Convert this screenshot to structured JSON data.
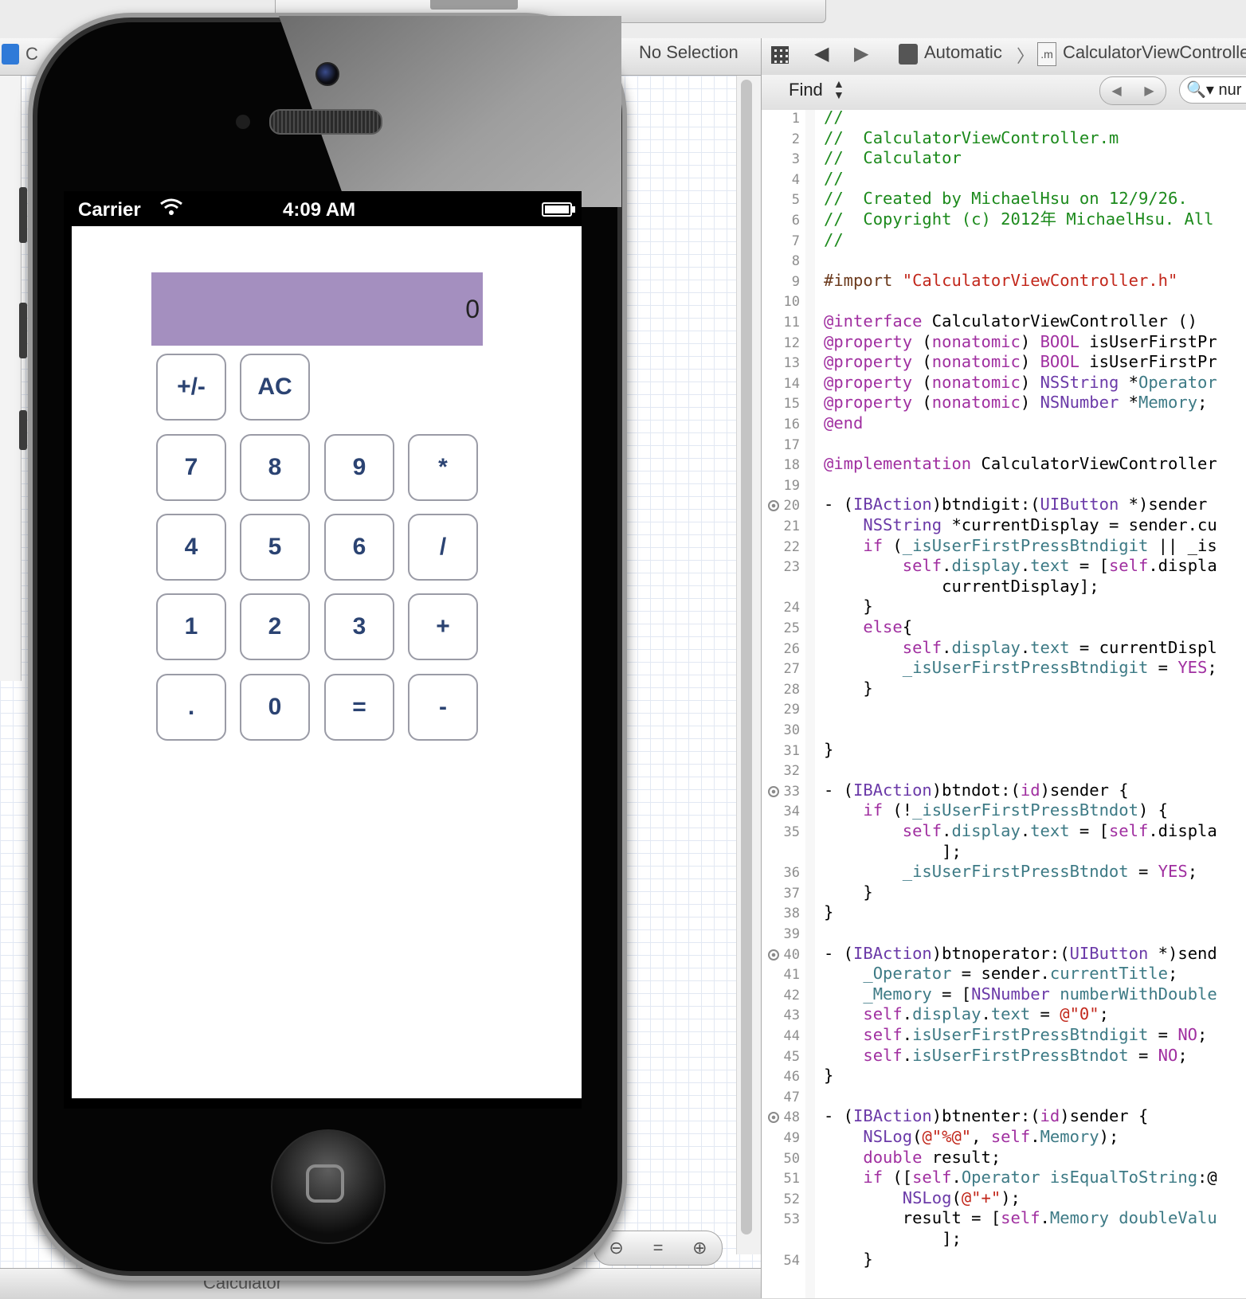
{
  "left_pane": {
    "file_label": "C",
    "breadcrumb_chevron": ")",
    "breadcrumb_arrow": "〉",
    "no_selection": "No Selection",
    "bottom_label": "Calculator",
    "zoom": {
      "out": "⊖",
      "fit": "=",
      "in": "⊕"
    }
  },
  "simulator": {
    "status": {
      "carrier": "Carrier",
      "time": "4:09 AM",
      "wifi_icon": "wifi-icon"
    },
    "display_value": "0",
    "display_color": "#a48fbf",
    "buttons": [
      [
        "+/-",
        "AC"
      ],
      [
        "7",
        "8",
        "9",
        "*"
      ],
      [
        "4",
        "5",
        "6",
        "/"
      ],
      [
        "1",
        "2",
        "3",
        "+"
      ],
      [
        ".",
        "0",
        "=",
        "-"
      ]
    ]
  },
  "editor": {
    "jump_bar": {
      "automatic": "Automatic",
      "file": "CalculatorViewController.m",
      "m_icon": ".m"
    },
    "find": {
      "label": "Find",
      "search_value": "nur"
    },
    "line_numbers": [
      "1",
      "2",
      "3",
      "4",
      "5",
      "6",
      "7",
      "8",
      "9",
      "10",
      "11",
      "12",
      "13",
      "14",
      "15",
      "16",
      "17",
      "18",
      "19",
      "20",
      "21",
      "22",
      "23",
      "",
      "24",
      "25",
      "26",
      "27",
      "28",
      "29",
      "30",
      "31",
      "32",
      "33",
      "34",
      "35",
      "",
      "36",
      "37",
      "38",
      "39",
      "40",
      "41",
      "42",
      "43",
      "44",
      "45",
      "46",
      "47",
      "48",
      "49",
      "50",
      "51",
      "52",
      "53",
      "",
      "54"
    ],
    "breakpoints_on_lines": [
      "20",
      "33",
      "40",
      "48"
    ],
    "code_lines": [
      "//",
      "//  CalculatorViewController.m",
      "//  Calculator",
      "//",
      "//  Created by MichaelHsu on 12/9/26.",
      "//  Copyright (c) 2012年 MichaelHsu. All",
      "//",
      "",
      "#import \"CalculatorViewController.h\"",
      "",
      "@interface CalculatorViewController ()",
      "@property (nonatomic) BOOL isUserFirstPr",
      "@property (nonatomic) BOOL isUserFirstPr",
      "@property (nonatomic) NSString *Operator",
      "@property (nonatomic) NSNumber *Memory;",
      "@end",
      "",
      "@implementation CalculatorViewController",
      "",
      "- (IBAction)btndigit:(UIButton *)sender",
      "    NSString *currentDisplay = sender.cu",
      "    if (_isUserFirstPressBtndigit || _is",
      "        self.display.text = [self.displa",
      "            currentDisplay];",
      "    }",
      "    else{",
      "        self.display.text = currentDispl",
      "        _isUserFirstPressBtndigit = YES;",
      "    }",
      "",
      "",
      "}",
      "",
      "- (IBAction)btndot:(id)sender {",
      "    if (!_isUserFirstPressBtndot) {",
      "        self.display.text = [self.displa",
      "            ];",
      "        _isUserFirstPressBtndot = YES;",
      "    }",
      "}",
      "",
      "- (IBAction)btnoperator:(UIButton *)send",
      "    _Operator = sender.currentTitle;",
      "    _Memory = [NSNumber numberWithDouble",
      "    self.display.text = @\"0\";",
      "    self.isUserFirstPressBtndigit = NO;",
      "    self.isUserFirstPressBtndot = NO;",
      "}",
      "",
      "- (IBAction)btnenter:(id)sender {",
      "    NSLog(@\"%@\", self.Memory);",
      "    double result;",
      "    if ([self.Operator isEqualToString:@",
      "        NSLog(@\"+\");",
      "        result = [self.Memory doubleValu",
      "            ];",
      "    }"
    ]
  }
}
